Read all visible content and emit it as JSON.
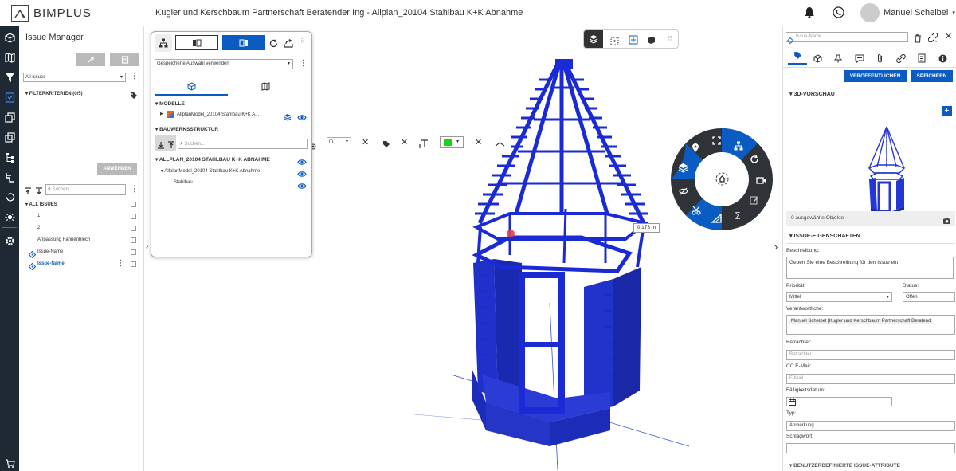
{
  "app": {
    "logo": "BIMPLUS",
    "project_title": "Kugler und Kerschbaum Partnerschaft Beratender Ing  -  Allplan_20104 Stahlbau K+K Abnahme",
    "user_name": "Manuel Scheibel"
  },
  "rail": {
    "icons": [
      "cube-icon",
      "map-icon",
      "filter-icon",
      "issue-icon",
      "copy-icon",
      "layers-icon",
      "hierarchy-icon",
      "tree-icon",
      "history-icon",
      "sun-icon",
      "settings-icon",
      "cart-icon"
    ]
  },
  "issue_manager": {
    "title": "Issue Manager",
    "filter_select": "All issues",
    "filter_label": "FILTERKRITERIEN (0/5)",
    "apply_label": "ANWENDEN",
    "search_placeholder": "Suchen...",
    "all_issues_label": "ALL ISSUES",
    "items": [
      {
        "label": "1"
      },
      {
        "label": "2"
      },
      {
        "label": "Anpassung Fahnenblech"
      },
      {
        "label": "Issue-Name"
      },
      {
        "label": "Issue-Name"
      }
    ]
  },
  "model_panel": {
    "selection_select": "Gespeicherte Auswahl verwenden",
    "section_models": "MODELLE",
    "model_name": "AllplanModel_20104 Stahlbau K+K A...",
    "section_structure": "BAUWERKSSTRUKTUR",
    "search_placeholder": "Suchen...",
    "tree": [
      {
        "label": "ALLPLAN_20104 STAHLBAU K+K ABNAHME"
      },
      {
        "label": "AllplanModel_20104 Stahlbau K+K Abnahme"
      },
      {
        "label": "Stahlbau"
      }
    ]
  },
  "mid_toolbar": {
    "unit": "m"
  },
  "measure_label": "0.173 m",
  "right_panel": {
    "issue_name_placeholder": "Issue-Name",
    "publish_label": "VERÖFFENTLICHEN",
    "save_label": "SPEICHERN",
    "preview_section": "3D-VORSCHAU",
    "selected_objects": "0 ausgewählte Objekte",
    "props_section": "ISSUE-EIGENSCHAFTEN",
    "description_label": "Beschreibung:",
    "description_value": "Geben Sie eine Beschreibung für den Issue ein",
    "priority_label": "Priorität:",
    "priority_value": "Mittel",
    "status_label": "Status:",
    "status_value": "Offen",
    "responsible_label": "Verantwortliche:",
    "responsible_value": "Manuel Scheibel [Kugler und Kerschbaum Partnerschaft Beratend",
    "viewer_label": "Betrachter:",
    "viewer_placeholder": "Betrachter",
    "cc_label": "CC E-Mail:",
    "cc_placeholder": "E-Mail",
    "due_label": "Fälligkeitsdatum:",
    "type_label": "Typ:",
    "type_value": "Anmerkung",
    "keyword_label": "Schlagwort:",
    "custom_section": "BENUTZERDEFINIERTE ISSUE-ATTRIBUTE"
  },
  "colors": {
    "accent": "#0a5cc2",
    "model_blue": "#1a2fd6",
    "rail_bg": "#1f2933"
  }
}
